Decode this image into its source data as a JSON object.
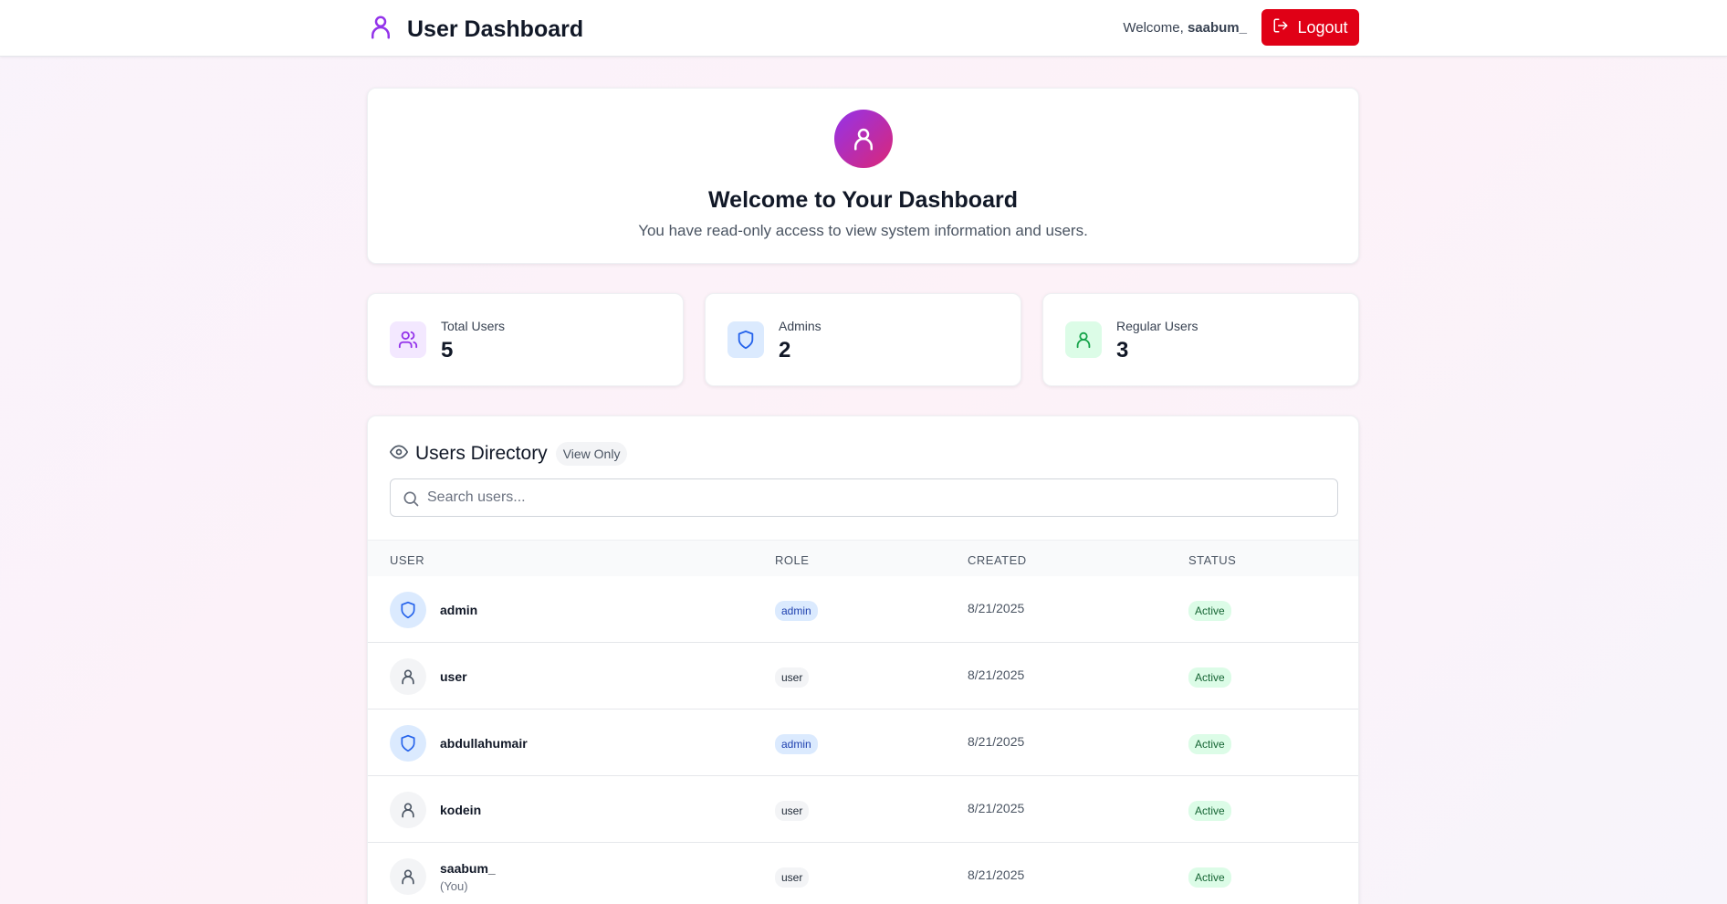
{
  "header": {
    "title": "User Dashboard",
    "welcome_prefix": "Welcome,",
    "username": "saabum_",
    "logout_label": "Logout"
  },
  "hero": {
    "title": "Welcome to Your Dashboard",
    "subtitle": "You have read-only access to view system information and users."
  },
  "stats": [
    {
      "label": "Total Users",
      "value": "5",
      "icon": "users-icon",
      "color": "#9333ea",
      "bg": "#f3e8ff"
    },
    {
      "label": "Admins",
      "value": "2",
      "icon": "shield-icon",
      "color": "#2563eb",
      "bg": "#dbeafe"
    },
    {
      "label": "Regular Users",
      "value": "3",
      "icon": "user-icon",
      "color": "#16a34a",
      "bg": "#dcfce7"
    }
  ],
  "directory": {
    "title": "Users Directory",
    "badge": "View Only",
    "search_placeholder": "Search users...",
    "columns": [
      "USER",
      "ROLE",
      "CREATED",
      "STATUS"
    ],
    "rows": [
      {
        "name": "admin",
        "role": "admin",
        "created": "8/21/2025",
        "status": "Active",
        "you": ""
      },
      {
        "name": "user",
        "role": "user",
        "created": "8/21/2025",
        "status": "Active",
        "you": ""
      },
      {
        "name": "abdullahumair",
        "role": "admin",
        "created": "8/21/2025",
        "status": "Active",
        "you": ""
      },
      {
        "name": "kodein",
        "role": "user",
        "created": "8/21/2025",
        "status": "Active",
        "you": ""
      },
      {
        "name": "saabum_",
        "role": "user",
        "created": "8/21/2025",
        "status": "Active",
        "you": "(You)"
      }
    ]
  },
  "colors": {
    "accent": "#9333ea",
    "logout": "#e00016",
    "admin_badge": "#dbeafe",
    "active_badge": "#dcfce7"
  }
}
